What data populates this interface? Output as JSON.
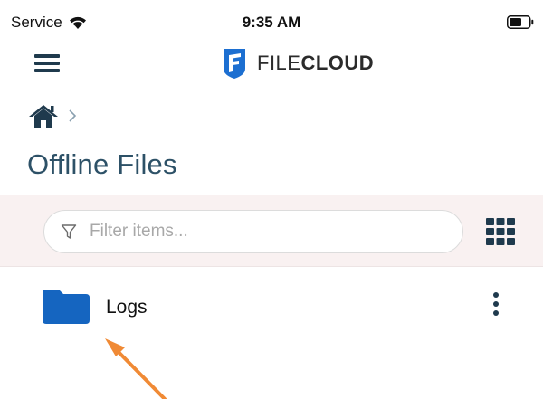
{
  "status_bar": {
    "carrier": "Service",
    "time": "9:35 AM",
    "icons": [
      "wifi-icon",
      "battery-icon"
    ]
  },
  "nav_bar": {
    "menu_icon": "hamburger-menu-icon",
    "logo_icon": "filecloud-logo-icon",
    "logo_text_light": "FILE",
    "logo_text_bold": "CLOUD"
  },
  "breadcrumb": {
    "home_icon": "home-icon",
    "separator_icon": "chevron-right-icon"
  },
  "page_title": "Offline Files",
  "filter": {
    "icon": "filter-funnel-icon",
    "placeholder": "Filter items...",
    "view_toggle_icon": "grid-view-icon"
  },
  "items": [
    {
      "name": "Logs",
      "type": "folder",
      "icon": "folder-icon",
      "menu_icon": "more-vertical-icon"
    }
  ],
  "annotation": {
    "icon": "arrow-icon",
    "color": "#f08a35"
  },
  "colors": {
    "brand_dark": "#1f3a4d",
    "title": "#2d5167",
    "folder": "#1565c0",
    "logo_blue": "#1c6fd1",
    "filter_bg": "#f9f1f1"
  }
}
